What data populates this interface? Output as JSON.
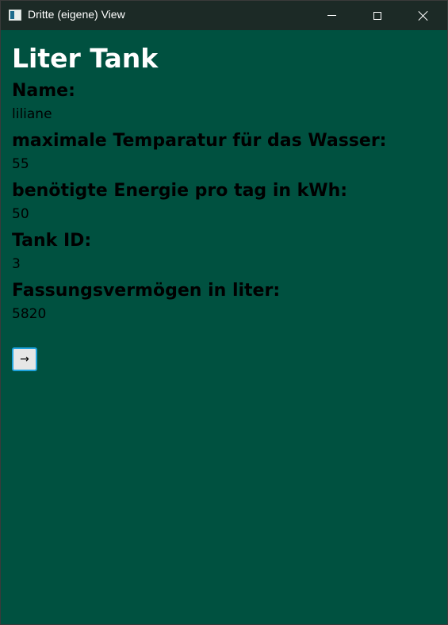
{
  "window": {
    "title": "Dritte (eigene) View"
  },
  "page": {
    "title": "Liter Tank",
    "fields": [
      {
        "label": "Name:",
        "value": "liliane"
      },
      {
        "label": "maximale Temparatur für das Wasser:",
        "value": "55"
      },
      {
        "label": "benötigte Energie pro tag in kWh:",
        "value": "50"
      },
      {
        "label": "Tank ID:",
        "value": "3"
      },
      {
        "label": "Fassungsvermögen in liter:",
        "value": "5820"
      }
    ],
    "next_button_label": "→"
  },
  "colors": {
    "background": "#005140",
    "titlebar": "#1c2a26",
    "button_border": "#1fa3dd"
  },
  "icons": {
    "app": "app-window-icon",
    "minimize": "minimize-icon",
    "maximize": "maximize-icon",
    "close": "close-icon"
  }
}
